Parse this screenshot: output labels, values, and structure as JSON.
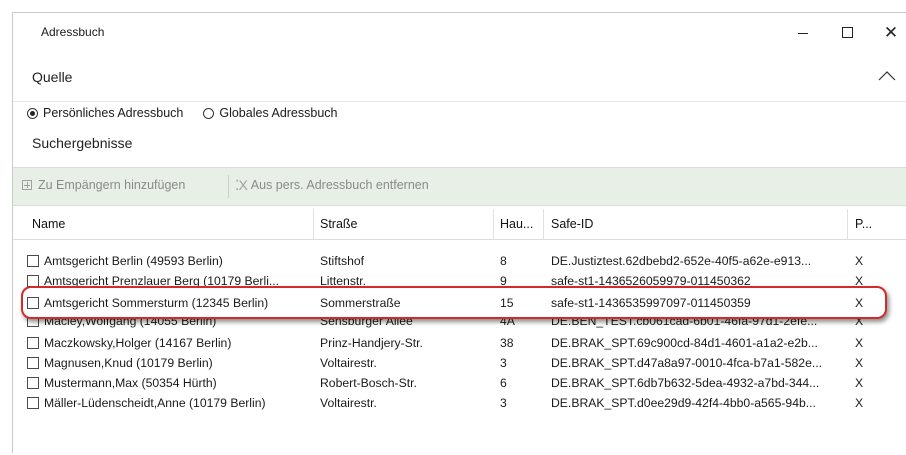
{
  "window": {
    "title": "Adressbuch",
    "controls": {
      "minimize": "—",
      "maximize": "☐",
      "close": "✕"
    }
  },
  "source": {
    "label": "Quelle",
    "options": [
      {
        "label": "Persönliches Adressbuch",
        "checked": true
      },
      {
        "label": "Globales Adressbuch",
        "checked": false
      }
    ]
  },
  "results": {
    "label": "Suchergebnisse"
  },
  "toolbar": {
    "add_label": "Zu Empängern hinzufügen",
    "remove_label": "Aus pers. Adressbuch entfernen"
  },
  "table": {
    "columns": [
      "Name",
      "Straße",
      "Hau...",
      "Safe-ID",
      "P..."
    ],
    "rows": [
      {
        "name": "Amtsgericht Berlin (49593 Berlin)",
        "street": "Stiftshof",
        "house": "8",
        "safe_id": "DE.Justiztest.62dbebd2-652e-40f5-a62e-e913...",
        "p": "X"
      },
      {
        "name": "Amtsgericht Prenzlauer Berg (10179 Berli...",
        "street": "Littenstr.",
        "house": "9",
        "safe_id": "safe-st1-1436526059979-011450362",
        "p": "X"
      },
      {
        "name": "Amtsgericht Sommersturm (12345 Berlin)",
        "street": "Sommerstraße",
        "house": "15",
        "safe_id": "safe-st1-1436535997097-011450359",
        "p": "X"
      },
      {
        "name": "Macley,Wolfgang (14055 Berlin)",
        "street": "Sensburger Allee",
        "house": "4A",
        "safe_id": "DE.BEN_TEST.cb061cad-6b01-46fa-97d1-2efe...",
        "p": "X"
      },
      {
        "name": "Maczkowsky,Holger (14167 Berlin)",
        "street": "Prinz-Handjery-Str.",
        "house": "38",
        "safe_id": "DE.BRAK_SPT.69c900cd-84d1-4601-a1a2-e2b...",
        "p": "X"
      },
      {
        "name": "Magnusen,Knud (10179 Berlin)",
        "street": "Voltairestr.",
        "house": "3",
        "safe_id": "DE.BRAK_SPT.d47a8a97-0010-4fca-b7a1-582e...",
        "p": "X"
      },
      {
        "name": "Mustermann,Max (50354 Hürth)",
        "street": "Robert-Bosch-Str.",
        "house": "6",
        "safe_id": "DE.BRAK_SPT.6db7b632-5dea-4932-a7bd-344...",
        "p": "X"
      },
      {
        "name": "Mäller-Lüdenscheidt,Anne (10179 Berlin)",
        "street": "Voltairestr.",
        "house": "3",
        "safe_id": "DE.BRAK_SPT.d0ee29d9-42f4-4bb0-a565-94b...",
        "p": "X"
      }
    ]
  },
  "colors": {
    "toolbar_bg": "#e7efe7",
    "highlight_border": "#d12b2b"
  },
  "icons": {
    "add": "plus-box-icon",
    "remove": "x-icon",
    "collapse": "chevron-up-icon"
  }
}
